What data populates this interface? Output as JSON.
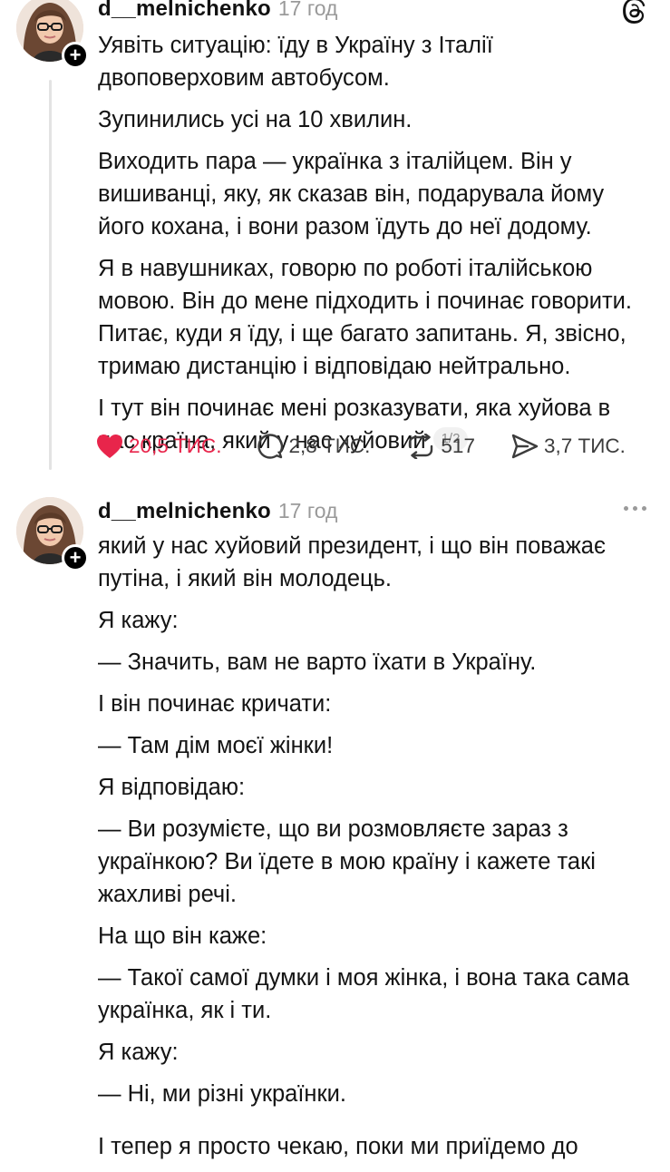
{
  "posts": [
    {
      "username": "d__melnichenko",
      "time": "17 год",
      "paragraphs": [
        "Уявіть ситуацію: їду в Україну з Італії двоповерховим автобусом.",
        "Зупинились усі на 10 хвилин.",
        "Виходить пара — українка з італійцем. Він у вишиванці, яку, як сказав він, подарувала йому його кохана, і вони разом їдуть до неї додому.",
        "Я в навушниках, говорю по роботі італійською мовою. Він до мене підходить і починає говорити. Питає, куди я їду, і ще багато запитань. Я, звісно, тримаю дистанцію і відповідаю нейтрально.",
        "І тут він починає мені розказувати, яка хуйова в нас країна, який у нас хуйовий"
      ],
      "page_indicator": "1/2",
      "stats": {
        "likes": "20,5 ТИС.",
        "comments": "2,8 ТИС.",
        "reposts": "517",
        "shares": "3,7 ТИС."
      },
      "icons": {
        "like": "heart-icon",
        "comment": "comment-icon",
        "repost": "repost-icon",
        "share": "send-icon",
        "corner": "threads-logo-icon"
      }
    },
    {
      "username": "d__melnichenko",
      "time": "17 год",
      "paragraphs": [
        "який у нас хуйовий президент, і що він поважає путіна, і який він молодець.",
        "Я кажу:",
        "— Значить, вам не варто їхати в Україну.",
        "І він починає кричати:",
        "— Там дім моєї жінки!",
        "Я відповідаю:",
        "— Ви розумієте, що ви розмовляєте зараз з українкою? Ви їдете в мою країну і кажете такі жахливі речі.",
        "На що він каже:",
        "— Такої самої думки і моя жінка, і вона така сама українка, як і ти.",
        "Я кажу:",
        "— Ні, ми різні українки.",
        "І тепер я просто чекаю, поки ми приїдемо до"
      ],
      "icons": {
        "corner": "more-icon"
      }
    }
  ],
  "colors": {
    "like": "#e8254b",
    "muted": "#9a9a9a",
    "text": "#141414",
    "thread_line": "#e3e3e3"
  }
}
